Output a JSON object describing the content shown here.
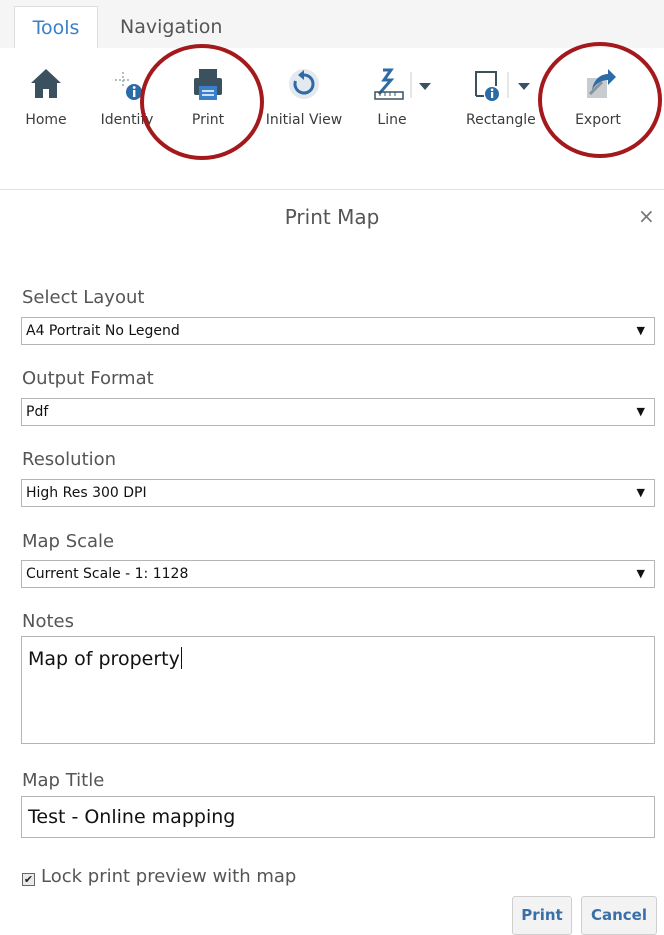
{
  "tabs": [
    {
      "label": "Tools",
      "active": true
    },
    {
      "label": "Navigation",
      "active": false
    }
  ],
  "toolbar": {
    "home": {
      "label": "Home",
      "icon": "home-icon"
    },
    "identify": {
      "label": "Identify",
      "icon": "identify-icon"
    },
    "print": {
      "label": "Print",
      "icon": "printer-icon"
    },
    "initial_view": {
      "label": "Initial View",
      "icon": "refresh-icon"
    },
    "line": {
      "label": "Line",
      "icon": "measure-line-icon"
    },
    "rectangle": {
      "label": "Rectangle",
      "icon": "rectangle-info-icon"
    },
    "export": {
      "label": "Export",
      "icon": "export-icon"
    }
  },
  "highlight_color": "#a3191c",
  "accent_color": "#3a80c9",
  "panel": {
    "title": "Print Map",
    "close_glyph": "×",
    "layout": {
      "label": "Select Layout",
      "value": "A4 Portrait No Legend"
    },
    "format": {
      "label": "Output Format",
      "value": "Pdf"
    },
    "resolution": {
      "label": "Resolution",
      "value": "High Res 300 DPI"
    },
    "scale": {
      "label": "Map Scale",
      "value": "Current Scale - 1: 1128"
    },
    "notes": {
      "label": "Notes",
      "value": "Map of property"
    },
    "map_title": {
      "label": "Map Title",
      "value": "Test - Online mapping"
    },
    "lock_preview": {
      "label": "Lock print preview with map",
      "checked": true
    },
    "print_button": "Print",
    "cancel_button": "Cancel"
  }
}
